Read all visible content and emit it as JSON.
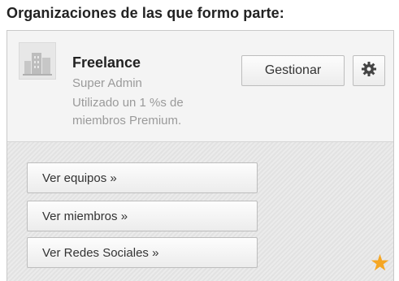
{
  "heading": "Organizaciones de las que formo parte:",
  "organization": {
    "name": "Freelance",
    "role": "Super Admin",
    "note": "Utilizado un 1 %s de miembros Premium.",
    "manage_label": "Gestionar",
    "settings_icon": "gear-icon",
    "logo_icon": "building-icon"
  },
  "links": [
    {
      "label": "Ver equipos »"
    },
    {
      "label": "Ver miembros »"
    },
    {
      "label": "Ver Redes Sociales »"
    }
  ],
  "favorite_icon": "star-icon",
  "colors": {
    "star": "#f5a623"
  }
}
